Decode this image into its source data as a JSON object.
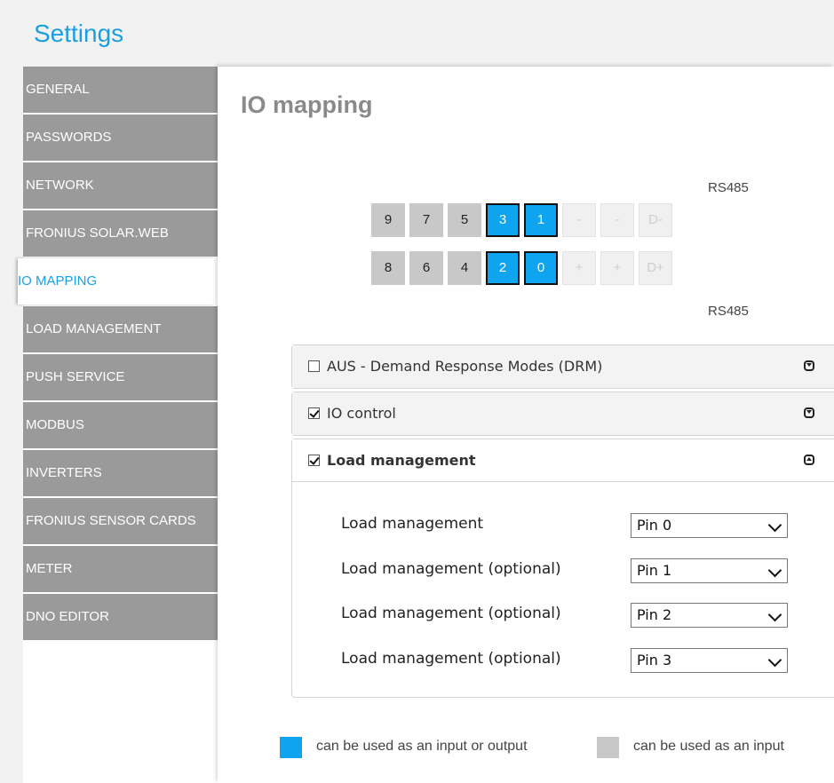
{
  "app": {
    "title": "Settings"
  },
  "sidebar": {
    "items": [
      {
        "label": "GENERAL"
      },
      {
        "label": "PASSWORDS"
      },
      {
        "label": "NETWORK"
      },
      {
        "label": "FRONIUS SOLAR.WEB"
      },
      {
        "label": "IO MAPPING",
        "active": true
      },
      {
        "label": "LOAD MANAGEMENT"
      },
      {
        "label": "PUSH SERVICE"
      },
      {
        "label": "MODBUS"
      },
      {
        "label": "INVERTERS"
      },
      {
        "label": "FRONIUS SENSOR CARDS"
      },
      {
        "label": "METER"
      },
      {
        "label": "DNO EDITOR"
      }
    ]
  },
  "main": {
    "title": "IO mapping",
    "pin_grid": {
      "rs485_top": "RS485",
      "rs485_bottom": "RS485",
      "top_row": [
        {
          "label": "9",
          "kind": "input"
        },
        {
          "label": "7",
          "kind": "input"
        },
        {
          "label": "5",
          "kind": "input"
        },
        {
          "label": "3",
          "kind": "io"
        },
        {
          "label": "1",
          "kind": "io"
        },
        {
          "label": "-",
          "kind": "disabled"
        },
        {
          "label": "-",
          "kind": "disabled"
        },
        {
          "label": "D-",
          "kind": "disabled"
        }
      ],
      "bottom_row": [
        {
          "label": "8",
          "kind": "input"
        },
        {
          "label": "6",
          "kind": "input"
        },
        {
          "label": "4",
          "kind": "input"
        },
        {
          "label": "2",
          "kind": "io"
        },
        {
          "label": "0",
          "kind": "io"
        },
        {
          "label": "+",
          "kind": "disabled"
        },
        {
          "label": "+",
          "kind": "disabled"
        },
        {
          "label": "D+",
          "kind": "disabled"
        }
      ]
    },
    "sections": {
      "drm": {
        "label": "AUS - Demand Response Modes (DRM)",
        "checked": false,
        "expanded": false
      },
      "io_control": {
        "label": "IO control",
        "checked": true,
        "expanded": false
      },
      "load_management": {
        "label": "Load management",
        "checked": true,
        "expanded": true
      }
    },
    "load_rows": [
      {
        "label": "Load management",
        "value": "Pin 0"
      },
      {
        "label": "Load management (optional)",
        "value": "Pin 1"
      },
      {
        "label": "Load management (optional)",
        "value": "Pin 2"
      },
      {
        "label": "Load management (optional)",
        "value": "Pin 3"
      }
    ],
    "legend": {
      "io_label": "can be used as an input or output",
      "input_label": "can be used as an input"
    }
  },
  "colors": {
    "accent": "#1a9fe0",
    "io_pin": "#0ea4ef",
    "input_pin": "#c8c8c8",
    "sidebar_item": "#9a9a9a"
  },
  "icons": {
    "collapsed_toggle": "chevron-down-box-icon",
    "expanded_toggle": "chevron-up-box-icon",
    "select_arrow": "chevron-down-icon"
  }
}
